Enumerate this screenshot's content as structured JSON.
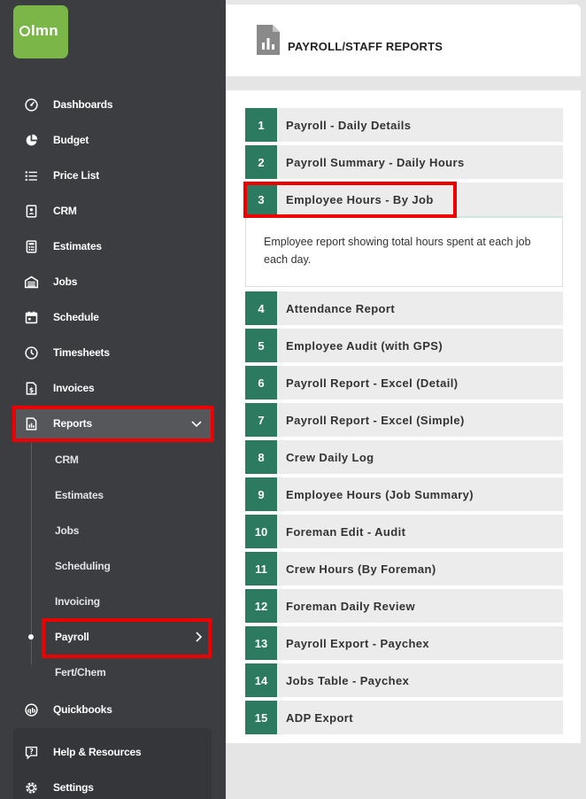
{
  "logo": {
    "text": "lmn",
    "color": "#7ab648"
  },
  "sidebar": {
    "items": [
      {
        "label": "Dashboards",
        "icon": "dashboard-gauge-icon"
      },
      {
        "label": "Budget",
        "icon": "pie-chart-icon"
      },
      {
        "label": "Price List",
        "icon": "list-icon"
      },
      {
        "label": "CRM",
        "icon": "contact-card-icon"
      },
      {
        "label": "Estimates",
        "icon": "calculator-icon"
      },
      {
        "label": "Jobs",
        "icon": "garage-icon"
      },
      {
        "label": "Schedule",
        "icon": "calendar-icon"
      },
      {
        "label": "Timesheets",
        "icon": "clock-icon"
      },
      {
        "label": "Invoices",
        "icon": "invoice-dollar-icon"
      },
      {
        "label": "Reports",
        "icon": "report-chart-icon",
        "active": true
      }
    ],
    "sub_items": [
      {
        "label": "CRM"
      },
      {
        "label": "Estimates"
      },
      {
        "label": "Jobs"
      },
      {
        "label": "Scheduling"
      },
      {
        "label": "Invoicing"
      },
      {
        "label": "Payroll",
        "active": true
      },
      {
        "label": "Fert/Chem"
      }
    ],
    "bottom_items": [
      {
        "label": "Quickbooks",
        "icon": "quickbooks-icon"
      },
      {
        "label": "Help & Resources",
        "icon": "help-chat-icon"
      },
      {
        "label": "Settings",
        "icon": "gear-icon"
      }
    ]
  },
  "header": {
    "title": "PAYROLL/STAFF REPORTS",
    "icon": "report-document-icon"
  },
  "reports": [
    {
      "num": "1",
      "label": "Payroll - Daily Details"
    },
    {
      "num": "2",
      "label": "Payroll Summary - Daily Hours"
    },
    {
      "num": "3",
      "label": "Employee Hours - By Job",
      "expanded": true,
      "description": "Employee report showing total hours spent at each job each day."
    },
    {
      "num": "4",
      "label": "Attendance Report"
    },
    {
      "num": "5",
      "label": "Employee Audit (with GPS)"
    },
    {
      "num": "6",
      "label": "Payroll Report - Excel (Detail)"
    },
    {
      "num": "7",
      "label": "Payroll Report - Excel (Simple)"
    },
    {
      "num": "8",
      "label": "Crew Daily Log"
    },
    {
      "num": "9",
      "label": "Employee Hours (Job Summary)"
    },
    {
      "num": "10",
      "label": "Foreman Edit - Audit"
    },
    {
      "num": "11",
      "label": "Crew Hours (By Foreman)"
    },
    {
      "num": "12",
      "label": "Foreman Daily Review"
    },
    {
      "num": "13",
      "label": "Payroll Export - Paychex"
    },
    {
      "num": "14",
      "label": "Jobs Table - Paychex"
    },
    {
      "num": "15",
      "label": "ADP Export"
    }
  ],
  "colors": {
    "accent": "#2c7a60",
    "sidebar": "#3c3d40",
    "highlight": "#ee0000"
  }
}
